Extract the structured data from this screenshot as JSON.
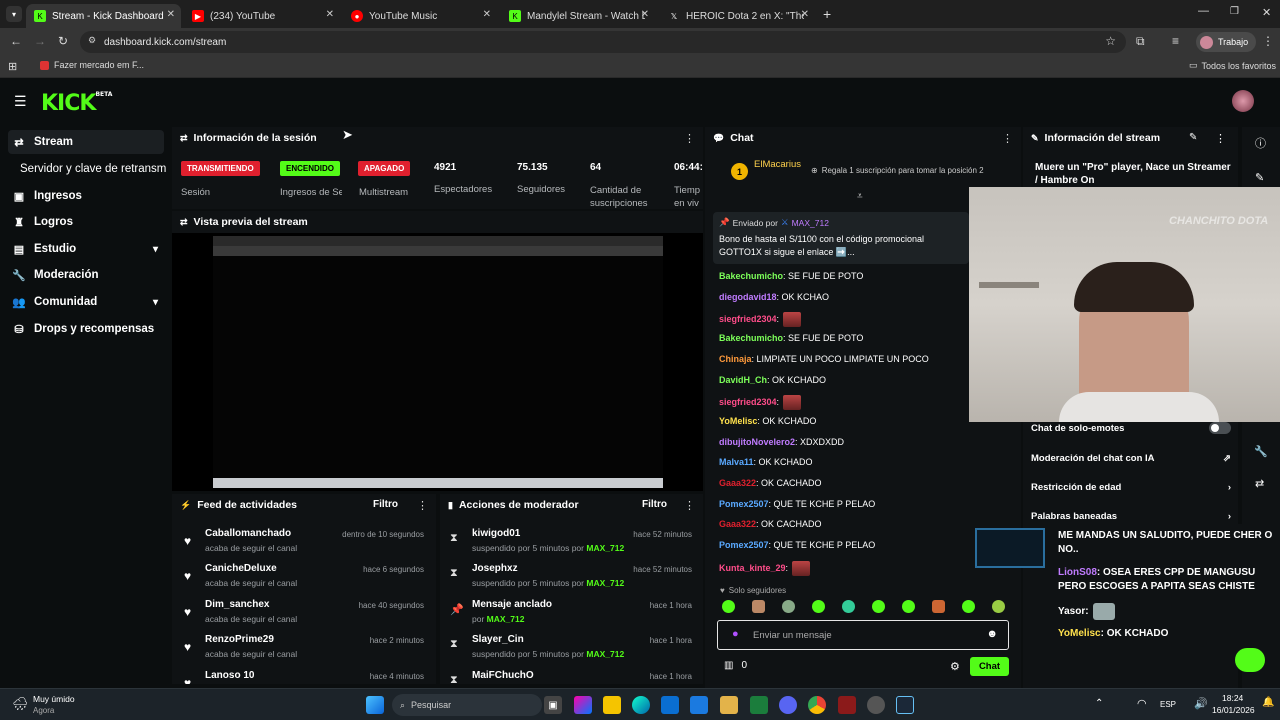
{
  "browser": {
    "tabs": [
      {
        "title": "Stream - Kick Dashboard",
        "active": true
      },
      {
        "title": "(234) YouTube",
        "active": false
      },
      {
        "title": "YouTube Music",
        "active": false
      },
      {
        "title": "Mandylel Stream - Watch Live o",
        "active": false
      },
      {
        "title": "HEROIC Dota 2 en X: \"The your",
        "active": false
      }
    ],
    "url": "dashboard.kick.com/stream",
    "profile": "Trabajo",
    "bookmark": "Fazer mercado em F...",
    "all_favorites": "Todos los favoritos"
  },
  "app": {
    "logo": "KICK",
    "logo_badge": "BETA"
  },
  "sidebar": {
    "items": [
      {
        "label": "Stream",
        "icon": "stream-icon",
        "active": true
      },
      {
        "label": "Servidor y clave de retransm"
      },
      {
        "label": "Ingresos",
        "icon": "income-icon"
      },
      {
        "label": "Logros",
        "icon": "trophy-icon"
      },
      {
        "label": "Estudio",
        "icon": "studio-icon",
        "expandable": true
      },
      {
        "label": "Moderación",
        "icon": "wrench-icon"
      },
      {
        "label": "Comunidad",
        "icon": "community-icon",
        "expandable": true
      },
      {
        "label": "Drops y recompensas",
        "icon": "drops-icon"
      }
    ]
  },
  "session": {
    "title": "Información de la sesión",
    "badges": [
      {
        "label": "TRANSMITIENDO",
        "caption": "Sesión",
        "color": "#e0202e"
      },
      {
        "label": "ENCENDIDO",
        "caption": "Ingresos de Sesio",
        "color": "#53fc18"
      },
      {
        "label": "APAGADO",
        "caption": "Multistream",
        "color": "#e0202e"
      }
    ],
    "stats": [
      {
        "value": "4921",
        "label": "Espectadores"
      },
      {
        "value": "75.135",
        "label": "Seguidores"
      },
      {
        "value": "64",
        "label": "Cantidad de suscripciones"
      },
      {
        "value": "06:44:",
        "label": "Tiemp en viv"
      }
    ]
  },
  "preview": {
    "title": "Vista previa del stream"
  },
  "activity_feed": {
    "title": "Feed de actividades",
    "filter": "Filtro",
    "items": [
      {
        "name": "Caballomanchado",
        "action": "acaba de seguir el canal",
        "time": "dentro de 10 segundos"
      },
      {
        "name": "CanicheDeluxe",
        "action": "acaba de seguir el canal",
        "time": "hace 6 segundos"
      },
      {
        "name": "Dim_sanchex",
        "action": "acaba de seguir el canal",
        "time": "hace 40 segundos"
      },
      {
        "name": "RenzoPrime29",
        "action": "acaba de seguir el canal",
        "time": "hace 2 minutos"
      },
      {
        "name": "Lanoso 10",
        "action": "",
        "time": "hace 4 minutos"
      }
    ]
  },
  "mod_actions": {
    "title": "Acciones de moderador",
    "filter": "Filtro",
    "items": [
      {
        "name": "kiwigod01",
        "prefix": "suspendido por 5 minutos por",
        "mod": "MAX_712",
        "time": "hace 52 minutos",
        "icon": "hourglass-icon"
      },
      {
        "name": "Josephxz",
        "prefix": "suspendido por 5 minutos por",
        "mod": "MAX_712",
        "time": "hace 52 minutos",
        "icon": "hourglass-icon"
      },
      {
        "name": "Mensaje anclado",
        "prefix": "por",
        "mod": "MAX_712",
        "time": "hace 1 hora",
        "icon": "pin-icon"
      },
      {
        "name": "Slayer_Cin",
        "prefix": "suspendido por 5 minutos por",
        "mod": "MAX_712",
        "time": "hace 1 hora",
        "icon": "hourglass-icon"
      },
      {
        "name": "MaiFChuchO",
        "prefix": "",
        "mod": "",
        "time": "hace 1 hora",
        "icon": "hourglass-icon"
      }
    ]
  },
  "chat": {
    "title": "Chat",
    "top_user": "ElMacarius",
    "gift_text": "Regala 1 suscripción para tomar la posición 2",
    "pinned": {
      "sent_by": "Enviado por",
      "user": "MAX_712",
      "text": "Bono de hasta el S/1100 con el código promocional GOTTO1X si sigue el enlace ➡️..."
    },
    "messages": [
      {
        "user": "Bakechumicho",
        "color": "#7dff5a",
        "text": ": SE FUE DE POTO"
      },
      {
        "user": "diegodavid18",
        "color": "#c07cff",
        "text": ": OK KCHAO"
      },
      {
        "user": "siegfried2304",
        "color": "#ff4d8a",
        "text": ":",
        "emote": true
      },
      {
        "user": "Bakechumicho",
        "color": "#7dff5a",
        "text": ": SE FUE DE POTO"
      },
      {
        "user": "Chinaja",
        "color": "#ff9a3c",
        "text": ": LIMPIATE UN POCO LIMPIATE UN POCO"
      },
      {
        "user": "DavidH_Ch",
        "color": "#7dff5a",
        "text": ": OK KCHADO"
      },
      {
        "user": "siegfried2304",
        "color": "#ff4d8a",
        "text": ":",
        "emote": true
      },
      {
        "user": "YoMelisc",
        "color": "#ffe14d",
        "text": ": OK KCHADO"
      },
      {
        "user": "dibujitoNovelero2",
        "color": "#c07cff",
        "text": ": XDXDXDD"
      },
      {
        "user": "Malva11",
        "color": "#5aa9ff",
        "text": ": OK KCHADO"
      },
      {
        "user": "Gaaa322",
        "color": "#e0202e",
        "text": ": OK CACHADO"
      },
      {
        "user": "Pomex2507",
        "color": "#5aa9ff",
        "text": ": QUE TE KCHE P PELAO"
      },
      {
        "user": "Gaaa322",
        "color": "#e0202e",
        "text": ": OK CACHADO"
      },
      {
        "user": "Pomex2507",
        "color": "#5aa9ff",
        "text": ": QUE TE KCHE P PELAO"
      },
      {
        "user": "Kunta_kinte_29",
        "color": "#ff4d8a",
        "text": ":",
        "emote": true
      }
    ],
    "followers_only": "Solo seguidores",
    "input_placeholder": "Enviar un mensaje",
    "points": "0",
    "send": "Chat"
  },
  "stream_info": {
    "title": "Información del stream",
    "stream_title": "Muere un \"Pro\" player, Nace un Streamer / Hambre On",
    "watermark": "CHANCHITO DOTA",
    "settings": [
      {
        "label": "Chat de solo-emotes",
        "control": "toggle"
      },
      {
        "label": "Moderación del chat con IA",
        "control": "external"
      },
      {
        "label": "Restricción de edad",
        "control": "chevron"
      },
      {
        "label": "Palabras baneadas",
        "control": "chevron"
      }
    ]
  },
  "overlay_chat": [
    {
      "user": "",
      "text": "ME MANDAS UN SALUDITO, PUEDE CHER O NO..",
      "color": "#ffffff"
    },
    {
      "user": "LionS08",
      "text": ": OSEA ERES CPP DE MANGUSU PERO ESCOGES A PAPITA SEAS CHISTE",
      "color": "#c07cff"
    },
    {
      "user": "Yasor",
      "text": ":",
      "color": "#ffffff"
    },
    {
      "user": "YoMelisc",
      "text": ": OK KCHADO",
      "color": "#ffe14d"
    }
  ],
  "taskbar": {
    "weather": "Muy úmido",
    "weather_sub": "Agora",
    "search": "Pesquisar",
    "lang": "ESP",
    "time": "18:24",
    "date": "16/01/2026"
  }
}
